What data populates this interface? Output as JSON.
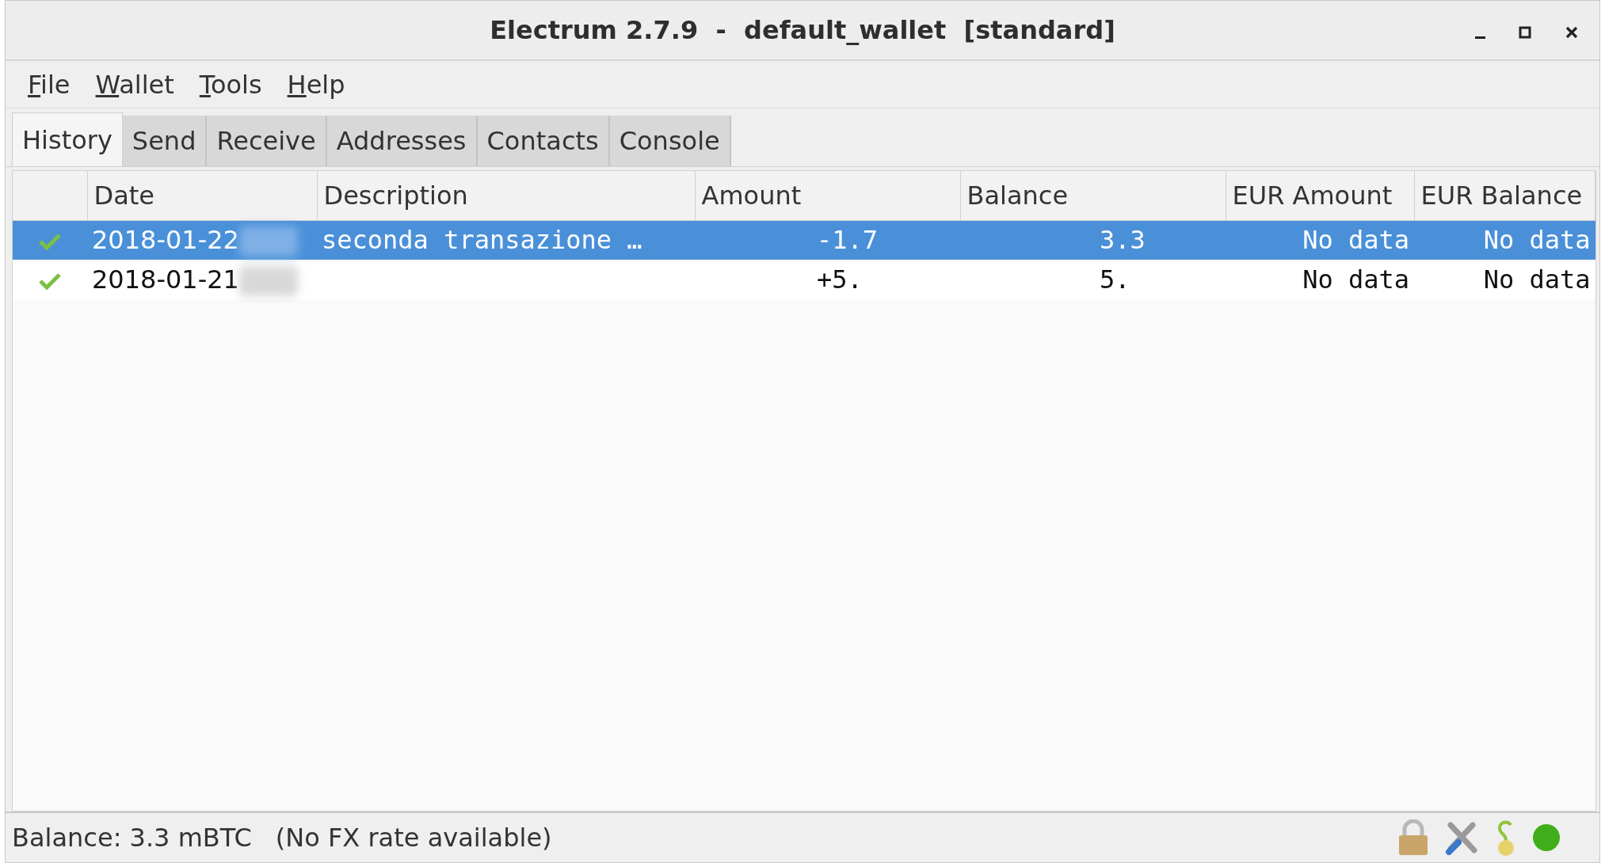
{
  "window": {
    "title": "Electrum 2.7.9  -  default_wallet  [standard]"
  },
  "menu": [
    {
      "label": "File"
    },
    {
      "label": "Wallet"
    },
    {
      "label": "Tools"
    },
    {
      "label": "Help"
    }
  ],
  "tabs": [
    {
      "label": "History",
      "selected": true
    },
    {
      "label": "Send",
      "selected": false
    },
    {
      "label": "Receive",
      "selected": false
    },
    {
      "label": "Addresses",
      "selected": false
    },
    {
      "label": "Contacts",
      "selected": false
    },
    {
      "label": "Console",
      "selected": false
    }
  ],
  "table": {
    "columns": [
      "Date",
      "Description",
      "Amount",
      "Balance",
      "EUR Amount",
      "EUR Balance"
    ],
    "rows": [
      {
        "selected": true,
        "confirmed": true,
        "date": "2018-01-22",
        "description": "seconda transazione …",
        "amount": "-1.7",
        "balance": "3.3",
        "eur_amount": "No data",
        "eur_balance": "No data"
      },
      {
        "selected": false,
        "confirmed": true,
        "date": "2018-01-21",
        "amount": "+5.",
        "balance": "5.",
        "eur_amount": "No data",
        "eur_balance": "No data"
      }
    ]
  },
  "status_bar": {
    "balance": "Balance: 3.3 mBTC",
    "fx": "(No FX rate available)"
  }
}
